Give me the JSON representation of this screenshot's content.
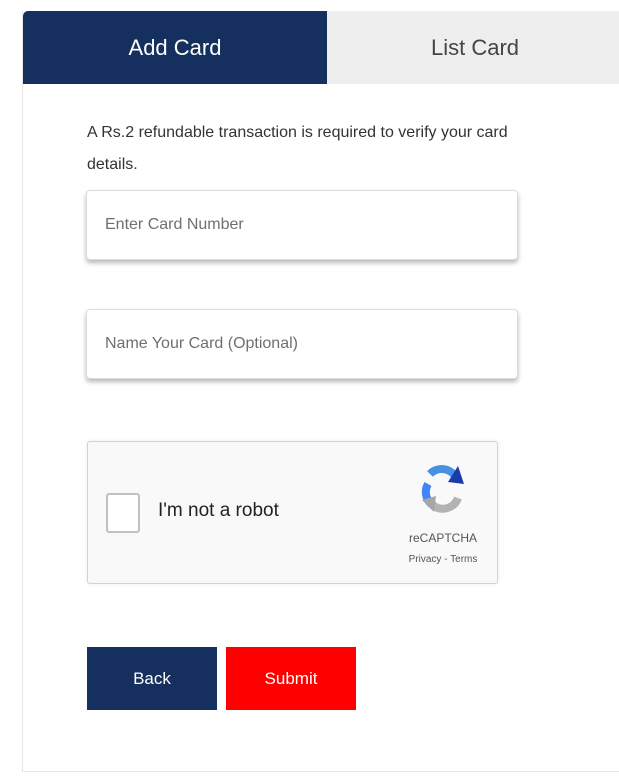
{
  "tabs": {
    "add_card": "Add Card",
    "list_card": "List Card"
  },
  "info": {
    "text": "A Rs.2 refundable transaction is required to verify your card details."
  },
  "fields": {
    "card_number": {
      "value": "",
      "placeholder": "Enter Card Number"
    },
    "card_name": {
      "value": "",
      "placeholder": "Name Your Card (Optional)"
    }
  },
  "recaptcha": {
    "label": "I'm not a robot",
    "brand": "reCAPTCHA",
    "privacy": "Privacy",
    "separator": " - ",
    "terms": "Terms",
    "checked": false,
    "icon": "recaptcha-logo-icon"
  },
  "buttons": {
    "back": "Back",
    "submit": "Submit"
  },
  "colors": {
    "primary": "#15305f",
    "submit": "#ff0000",
    "tab_inactive": "#eeeeee"
  }
}
